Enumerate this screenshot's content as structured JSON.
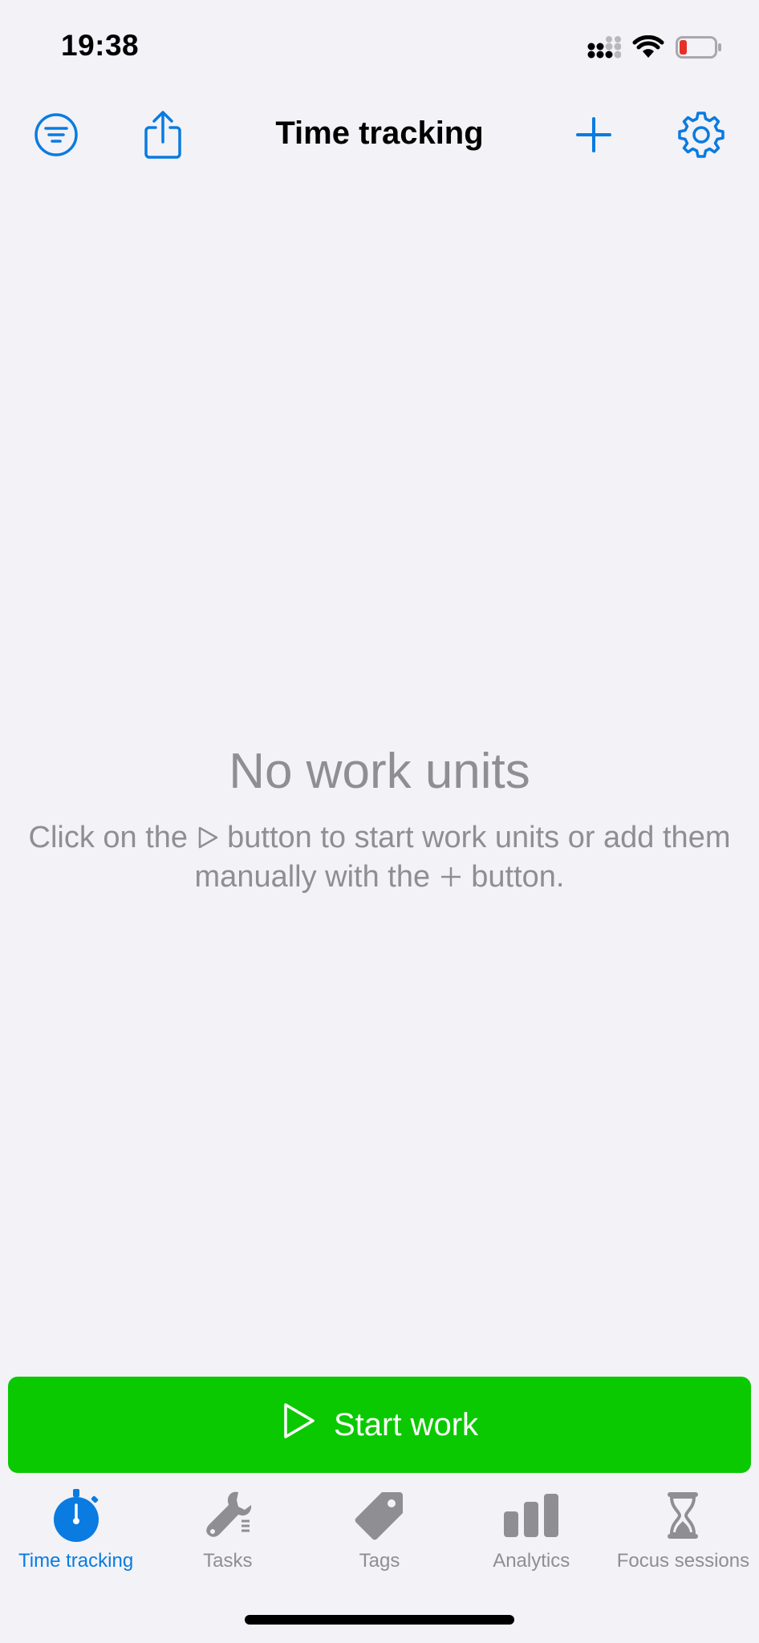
{
  "status_bar": {
    "time": "19:38"
  },
  "nav": {
    "title": "Time tracking"
  },
  "empty_state": {
    "title": "No work units",
    "message_part1": "Click on the ",
    "message_part2": " button to start work units or add them manually with the ",
    "message_part3": " button."
  },
  "start_button": {
    "label": "Start work"
  },
  "tabs": [
    {
      "label": "Time tracking",
      "icon": "stopwatch-icon",
      "active": true
    },
    {
      "label": "Tasks",
      "icon": "wrench-icon",
      "active": false
    },
    {
      "label": "Tags",
      "icon": "tag-icon",
      "active": false
    },
    {
      "label": "Analytics",
      "icon": "bar-chart-icon",
      "active": false
    },
    {
      "label": "Focus sessions",
      "icon": "hourglass-icon",
      "active": false
    }
  ],
  "colors": {
    "accent": "#0a7be0",
    "start_button": "#0bc900",
    "background": "#f2f2f7",
    "secondary_text": "#8e8e93",
    "battery_low": "#e5302a"
  }
}
